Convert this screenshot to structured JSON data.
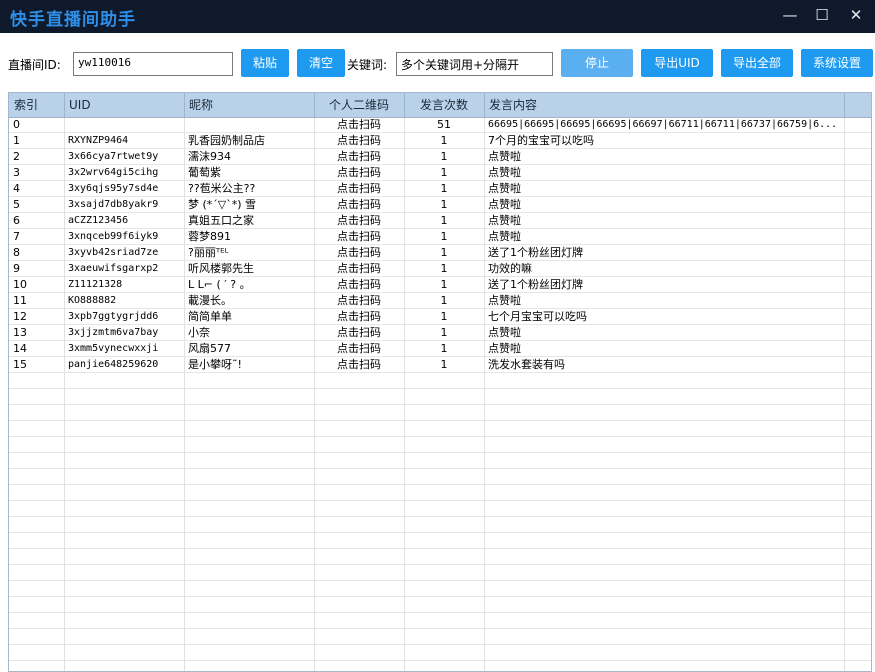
{
  "app": {
    "title": "快手直播间助手"
  },
  "window": {
    "minimize": "—",
    "maximize": "☐",
    "close": "✕"
  },
  "toolbar": {
    "room_label": "直播间ID:",
    "room_value": "yw110016",
    "paste": "粘贴",
    "clear": "清空",
    "keyword_label": "关键词:",
    "keyword_value": "多个关键词用+分隔开",
    "stop": "停止",
    "export_uid": "导出UID",
    "export_all": "导出全部",
    "settings": "系统设置"
  },
  "table": {
    "columns": [
      "索引",
      "UID",
      "昵称",
      "个人二维码",
      "发言次数",
      "发言内容"
    ],
    "rows": [
      [
        "0",
        "",
        "",
        "点击扫码",
        "51",
        "66695|66695|66695|66695|66697|66711|66711|66737|66759|6..."
      ],
      [
        "1",
        "RXYNZP9464",
        "乳香园奶制品店",
        "点击扫码",
        "1",
        "7个月的宝宝可以吃吗"
      ],
      [
        "2",
        "3x66cya7rtwet9y",
        "濡沫934",
        "点击扫码",
        "1",
        "点赞啦"
      ],
      [
        "3",
        "3x2wrv64gi5cihg",
        "葡萄紫",
        "点击扫码",
        "1",
        "点赞啦"
      ],
      [
        "4",
        "3xy6qjs95y7sd4e",
        "??苞米公主??",
        "点击扫码",
        "1",
        "点赞啦"
      ],
      [
        "5",
        "3xsajd7db8yakr9",
        "梦 (*ˊ▽ˋ*) 雪",
        "点击扫码",
        "1",
        "点赞啦"
      ],
      [
        "6",
        "aCZZ123456",
        "真姐五口之家",
        "点击扫码",
        "1",
        "点赞啦"
      ],
      [
        "7",
        "3xnqceb99f6iyk9",
        "蓉梦891",
        "点击扫码",
        "1",
        "点赞啦"
      ],
      [
        "8",
        "3xyvb42sriad7ze",
        "?丽丽ᵀᴱᴸ",
        "点击扫码",
        "1",
        "送了1个粉丝团灯牌"
      ],
      [
        "9",
        "3xaeuwifsgarxp2",
        "听风楼郭先生",
        "点击扫码",
        "1",
        "功效的嘛"
      ],
      [
        "10",
        "Z11121328",
        "L L⌐ ( ′ ? 。",
        "点击扫码",
        "1",
        "送了1个粉丝团灯牌"
      ],
      [
        "11",
        "KO888882",
        "載漫长。",
        "点击扫码",
        "1",
        "点赞啦"
      ],
      [
        "12",
        "3xpb7ggtygrjdd6",
        "简简单单",
        "点击扫码",
        "1",
        "七个月宝宝可以吃吗"
      ],
      [
        "13",
        "3xjjzmtm6va7bay",
        "小奈",
        "点击扫码",
        "1",
        "点赞啦"
      ],
      [
        "14",
        "3xmm5vynecwxxji",
        "风扇577",
        "点击扫码",
        "1",
        "点赞啦"
      ],
      [
        "15",
        "panjie648259620",
        "是小攀呀˜!",
        "点击扫码",
        "1",
        "洗发水套装有吗"
      ]
    ]
  },
  "colors": {
    "title_bar": "#0e1a2c",
    "title_text": "#2f8fe8",
    "button": "#1e9bf0",
    "header_bg": "#b9d2ea"
  }
}
